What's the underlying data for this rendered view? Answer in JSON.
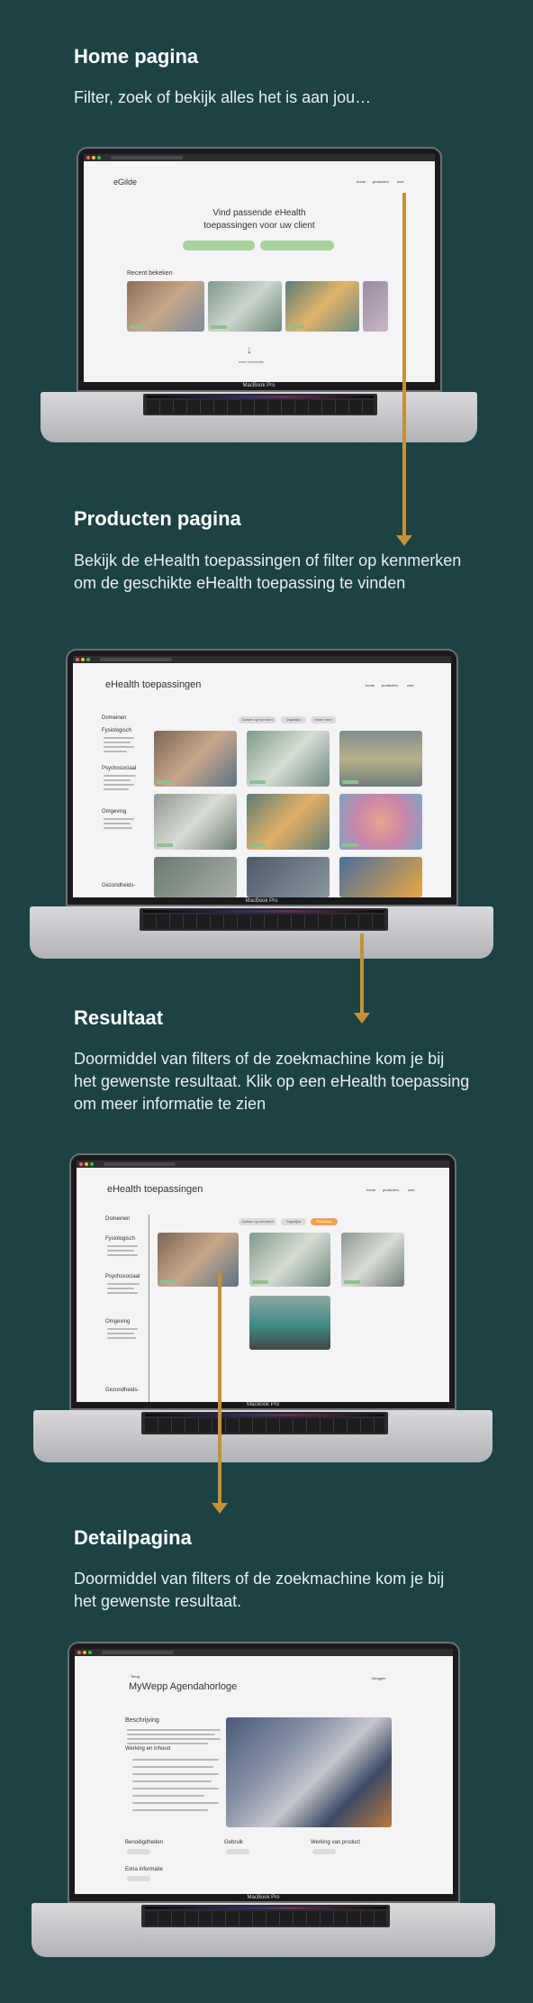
{
  "sections": [
    {
      "title": "Home pagina",
      "desc": "Filter, zoek of bekijk alles het is aan jou…"
    },
    {
      "title": "Producten pagina",
      "desc": "Bekijk de eHealth toepassingen of filter op kenmerken om de geschikte eHealth toepassing te vinden"
    },
    {
      "title": "Resultaat",
      "desc": "Doormiddel van filters of de zoekmachine kom je bij het gewenste resultaat. Klik op een eHealth toepassing om meer informatie te zien"
    },
    {
      "title": "Detailpagina",
      "desc": "Doormiddel van filters of de zoekmachine kom je bij het gewenste resultaat."
    }
  ],
  "laptop_brand": "MacBook Pro",
  "home_screen": {
    "logo": "eGilde",
    "nav": [
      "home",
      "producten",
      "over"
    ],
    "hero_title_1": "Vind passende eHealth",
    "hero_title_2": "toepassingen voor uw client",
    "recent_label": "Recent bekeken",
    "more_label": "meer informatie"
  },
  "products_screen": {
    "title": "eHealth toepassingen",
    "nav": [
      "home",
      "producten",
      "over"
    ],
    "filter_pills": [
      "Zoeken op kenmerk",
      "Dagelijks",
      "meer meer"
    ],
    "sidebar": {
      "heading": "Domeinen",
      "groups": [
        "Fysiologisch",
        "Psychosociaal",
        "Omgeving",
        "Gezondheids-"
      ]
    }
  },
  "result_screen": {
    "title": "eHealth toepassingen",
    "nav": [
      "home",
      "producten",
      "over"
    ],
    "filter_pills": [
      "Zoeken op kenmerk",
      "Dagelijks",
      "Resultaat"
    ],
    "sidebar": {
      "heading": "Domeinen",
      "groups": [
        "Fysiologisch",
        "Psychosociaal",
        "Omgeving",
        "Gezondheids-"
      ]
    }
  },
  "detail_screen": {
    "back": "Terug",
    "title": "MyWepp Agendahorloge",
    "login": "Inloggen",
    "beschrijving": "Beschrijving",
    "werking": "Werking en inhoud",
    "benodigdheden": "Benodigdheden",
    "gebruik": "Gebruik",
    "werking_product": "Werking van product",
    "extra": "Extra informatie"
  },
  "colors": {
    "background": "#1d4244",
    "arrow": "#c49235",
    "button_green": "#a8d29c",
    "accent_orange": "#f2a24a"
  }
}
